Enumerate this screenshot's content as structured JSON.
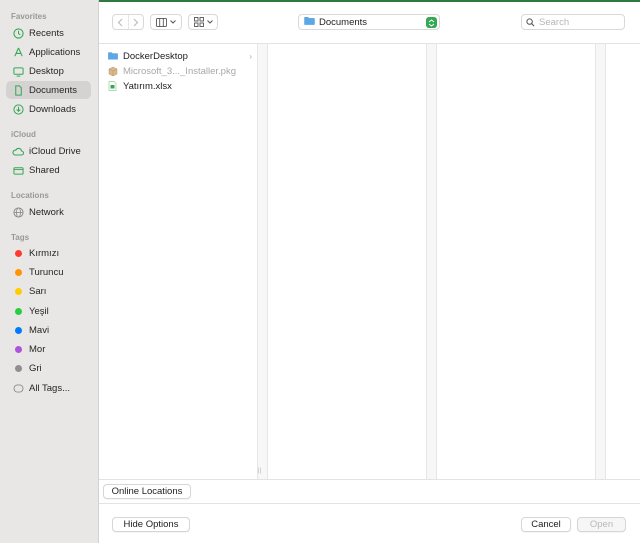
{
  "sidebar": {
    "favorites_header": "Favorites",
    "favorites": [
      {
        "label": "Recents",
        "icon": "clock-icon"
      },
      {
        "label": "Applications",
        "icon": "applications-icon"
      },
      {
        "label": "Desktop",
        "icon": "desktop-icon"
      },
      {
        "label": "Documents",
        "icon": "document-icon",
        "selected": true
      },
      {
        "label": "Downloads",
        "icon": "download-icon"
      }
    ],
    "icloud_header": "iCloud",
    "icloud": [
      {
        "label": "iCloud Drive",
        "icon": "cloud-icon"
      },
      {
        "label": "Shared",
        "icon": "shared-folder-icon"
      }
    ],
    "locations_header": "Locations",
    "locations": [
      {
        "label": "Network",
        "icon": "globe-icon"
      }
    ],
    "tags_header": "Tags",
    "tags": [
      {
        "label": "Kırmızı",
        "color": "#ff3b30"
      },
      {
        "label": "Turuncu",
        "color": "#ff9500"
      },
      {
        "label": "Sarı",
        "color": "#ffcc00"
      },
      {
        "label": "Yeşil",
        "color": "#28cd41"
      },
      {
        "label": "Mavi",
        "color": "#007aff"
      },
      {
        "label": "Mor",
        "color": "#af52de"
      },
      {
        "label": "Gri",
        "color": "#8e8e93"
      }
    ],
    "all_tags": "All Tags..."
  },
  "toolbar": {
    "path_label": "Documents",
    "search_placeholder": "Search"
  },
  "files": [
    {
      "name": "DockerDesktop",
      "type": "folder",
      "has_children": true
    },
    {
      "name": "Microsoft_3..._Installer.pkg",
      "type": "package",
      "dimmed": true
    },
    {
      "name": "Yatırım.xlsx",
      "type": "spreadsheet"
    }
  ],
  "bottom": {
    "online_locations": "Online Locations",
    "hide_options": "Hide Options",
    "cancel": "Cancel",
    "open": "Open"
  },
  "colors": {
    "accent_green": "#34a853",
    "folder_blue": "#5aa8e8",
    "sidebar_bg": "#e9e7e6"
  }
}
